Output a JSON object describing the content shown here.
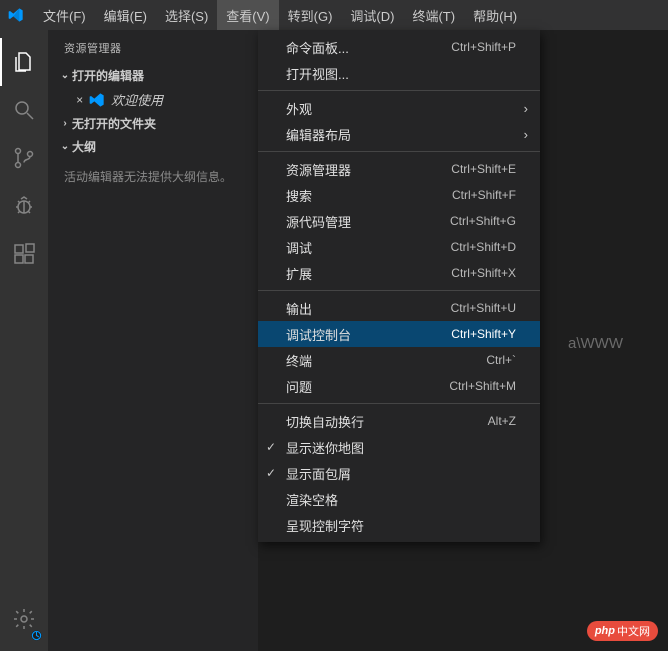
{
  "menubar": {
    "items": [
      {
        "label": "文件(F)"
      },
      {
        "label": "编辑(E)"
      },
      {
        "label": "选择(S)"
      },
      {
        "label": "查看(V)",
        "active": true
      },
      {
        "label": "转到(G)"
      },
      {
        "label": "调试(D)"
      },
      {
        "label": "终端(T)"
      },
      {
        "label": "帮助(H)"
      }
    ]
  },
  "sidebar": {
    "title": "资源管理器",
    "openEditorsLabel": "打开的编辑器",
    "welcomeLabel": "欢迎使用",
    "noFolderLabel": "无打开的文件夹",
    "outlineLabel": "大纲",
    "outlineMessage": "活动编辑器无法提供大纲信息。"
  },
  "dropdown": {
    "groups": [
      [
        {
          "label": "命令面板...",
          "shortcut": "Ctrl+Shift+P"
        },
        {
          "label": "打开视图..."
        }
      ],
      [
        {
          "label": "外观",
          "submenu": true
        },
        {
          "label": "编辑器布局",
          "submenu": true
        }
      ],
      [
        {
          "label": "资源管理器",
          "shortcut": "Ctrl+Shift+E"
        },
        {
          "label": "搜索",
          "shortcut": "Ctrl+Shift+F"
        },
        {
          "label": "源代码管理",
          "shortcut": "Ctrl+Shift+G"
        },
        {
          "label": "调试",
          "shortcut": "Ctrl+Shift+D"
        },
        {
          "label": "扩展",
          "shortcut": "Ctrl+Shift+X"
        }
      ],
      [
        {
          "label": "输出",
          "shortcut": "Ctrl+Shift+U"
        },
        {
          "label": "调试控制台",
          "shortcut": "Ctrl+Shift+Y",
          "highlighted": true
        },
        {
          "label": "终端",
          "shortcut": "Ctrl+`"
        },
        {
          "label": "问题",
          "shortcut": "Ctrl+Shift+M"
        }
      ],
      [
        {
          "label": "切换自动换行",
          "shortcut": "Alt+Z"
        },
        {
          "label": "显示迷你地图",
          "checked": true
        },
        {
          "label": "显示面包屑",
          "checked": true
        },
        {
          "label": "渲染空格"
        },
        {
          "label": "呈现控制字符"
        }
      ]
    ]
  },
  "editor": {
    "bgHint": "a\\WWW"
  },
  "watermark": {
    "php": "php",
    "text": "中文网"
  }
}
